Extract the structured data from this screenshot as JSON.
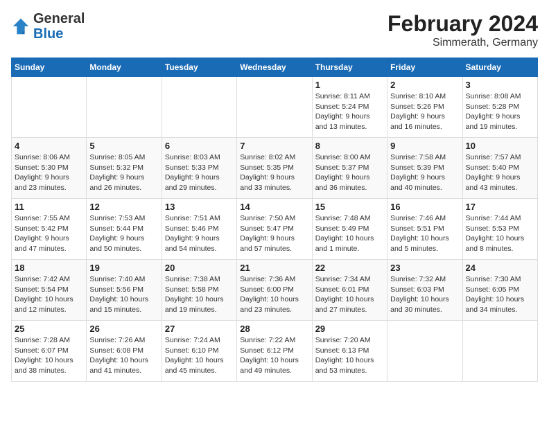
{
  "header": {
    "logo_general": "General",
    "logo_blue": "Blue",
    "title": "February 2024",
    "subtitle": "Simmerath, Germany"
  },
  "weekdays": [
    "Sunday",
    "Monday",
    "Tuesday",
    "Wednesday",
    "Thursday",
    "Friday",
    "Saturday"
  ],
  "weeks": [
    [
      {
        "day": "",
        "info": ""
      },
      {
        "day": "",
        "info": ""
      },
      {
        "day": "",
        "info": ""
      },
      {
        "day": "",
        "info": ""
      },
      {
        "day": "1",
        "info": "Sunrise: 8:11 AM\nSunset: 5:24 PM\nDaylight: 9 hours\nand 13 minutes."
      },
      {
        "day": "2",
        "info": "Sunrise: 8:10 AM\nSunset: 5:26 PM\nDaylight: 9 hours\nand 16 minutes."
      },
      {
        "day": "3",
        "info": "Sunrise: 8:08 AM\nSunset: 5:28 PM\nDaylight: 9 hours\nand 19 minutes."
      }
    ],
    [
      {
        "day": "4",
        "info": "Sunrise: 8:06 AM\nSunset: 5:30 PM\nDaylight: 9 hours\nand 23 minutes."
      },
      {
        "day": "5",
        "info": "Sunrise: 8:05 AM\nSunset: 5:32 PM\nDaylight: 9 hours\nand 26 minutes."
      },
      {
        "day": "6",
        "info": "Sunrise: 8:03 AM\nSunset: 5:33 PM\nDaylight: 9 hours\nand 29 minutes."
      },
      {
        "day": "7",
        "info": "Sunrise: 8:02 AM\nSunset: 5:35 PM\nDaylight: 9 hours\nand 33 minutes."
      },
      {
        "day": "8",
        "info": "Sunrise: 8:00 AM\nSunset: 5:37 PM\nDaylight: 9 hours\nand 36 minutes."
      },
      {
        "day": "9",
        "info": "Sunrise: 7:58 AM\nSunset: 5:39 PM\nDaylight: 9 hours\nand 40 minutes."
      },
      {
        "day": "10",
        "info": "Sunrise: 7:57 AM\nSunset: 5:40 PM\nDaylight: 9 hours\nand 43 minutes."
      }
    ],
    [
      {
        "day": "11",
        "info": "Sunrise: 7:55 AM\nSunset: 5:42 PM\nDaylight: 9 hours\nand 47 minutes."
      },
      {
        "day": "12",
        "info": "Sunrise: 7:53 AM\nSunset: 5:44 PM\nDaylight: 9 hours\nand 50 minutes."
      },
      {
        "day": "13",
        "info": "Sunrise: 7:51 AM\nSunset: 5:46 PM\nDaylight: 9 hours\nand 54 minutes."
      },
      {
        "day": "14",
        "info": "Sunrise: 7:50 AM\nSunset: 5:47 PM\nDaylight: 9 hours\nand 57 minutes."
      },
      {
        "day": "15",
        "info": "Sunrise: 7:48 AM\nSunset: 5:49 PM\nDaylight: 10 hours\nand 1 minute."
      },
      {
        "day": "16",
        "info": "Sunrise: 7:46 AM\nSunset: 5:51 PM\nDaylight: 10 hours\nand 5 minutes."
      },
      {
        "day": "17",
        "info": "Sunrise: 7:44 AM\nSunset: 5:53 PM\nDaylight: 10 hours\nand 8 minutes."
      }
    ],
    [
      {
        "day": "18",
        "info": "Sunrise: 7:42 AM\nSunset: 5:54 PM\nDaylight: 10 hours\nand 12 minutes."
      },
      {
        "day": "19",
        "info": "Sunrise: 7:40 AM\nSunset: 5:56 PM\nDaylight: 10 hours\nand 15 minutes."
      },
      {
        "day": "20",
        "info": "Sunrise: 7:38 AM\nSunset: 5:58 PM\nDaylight: 10 hours\nand 19 minutes."
      },
      {
        "day": "21",
        "info": "Sunrise: 7:36 AM\nSunset: 6:00 PM\nDaylight: 10 hours\nand 23 minutes."
      },
      {
        "day": "22",
        "info": "Sunrise: 7:34 AM\nSunset: 6:01 PM\nDaylight: 10 hours\nand 27 minutes."
      },
      {
        "day": "23",
        "info": "Sunrise: 7:32 AM\nSunset: 6:03 PM\nDaylight: 10 hours\nand 30 minutes."
      },
      {
        "day": "24",
        "info": "Sunrise: 7:30 AM\nSunset: 6:05 PM\nDaylight: 10 hours\nand 34 minutes."
      }
    ],
    [
      {
        "day": "25",
        "info": "Sunrise: 7:28 AM\nSunset: 6:07 PM\nDaylight: 10 hours\nand 38 minutes."
      },
      {
        "day": "26",
        "info": "Sunrise: 7:26 AM\nSunset: 6:08 PM\nDaylight: 10 hours\nand 41 minutes."
      },
      {
        "day": "27",
        "info": "Sunrise: 7:24 AM\nSunset: 6:10 PM\nDaylight: 10 hours\nand 45 minutes."
      },
      {
        "day": "28",
        "info": "Sunrise: 7:22 AM\nSunset: 6:12 PM\nDaylight: 10 hours\nand 49 minutes."
      },
      {
        "day": "29",
        "info": "Sunrise: 7:20 AM\nSunset: 6:13 PM\nDaylight: 10 hours\nand 53 minutes."
      },
      {
        "day": "",
        "info": ""
      },
      {
        "day": "",
        "info": ""
      }
    ]
  ]
}
